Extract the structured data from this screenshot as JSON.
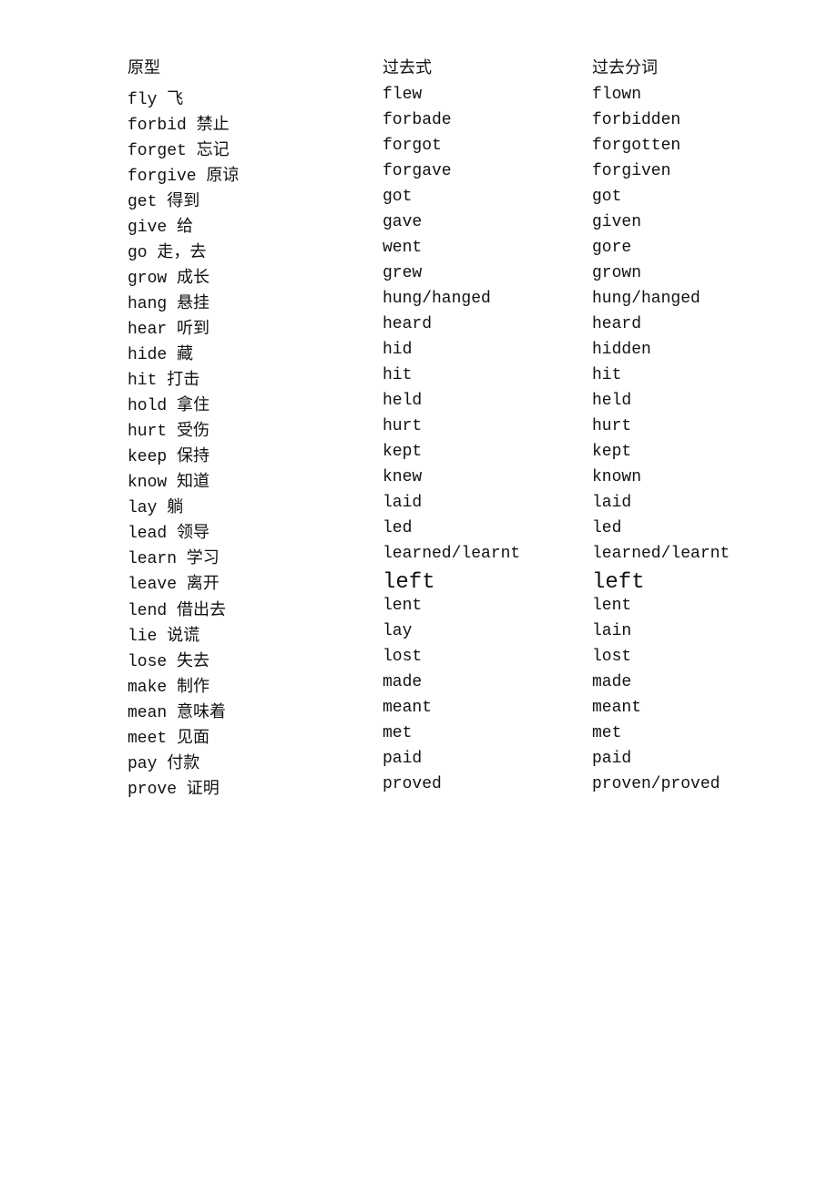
{
  "headers": {
    "col1": "原型",
    "col2": "过去式",
    "col3": "过去分词"
  },
  "rows": [
    {
      "col1": "fly 飞",
      "col2": "flew",
      "col3": "flown",
      "large": false
    },
    {
      "col1": "forbid 禁止",
      "col2": "forbade",
      "col3": "forbidden",
      "large": false
    },
    {
      "col1": "forget 忘记",
      "col2": "forgot",
      "col3": "forgotten",
      "large": false
    },
    {
      "col1": "forgive 原谅",
      "col2": "forgave",
      "col3": "forgiven",
      "large": false
    },
    {
      "col1": "get 得到",
      "col2": "got",
      "col3": "got",
      "large": false
    },
    {
      "col1": "give 给",
      "col2": "gave",
      "col3": "given",
      "large": false
    },
    {
      "col1": "go 走，去",
      "col2": "went",
      "col3": "gore",
      "large": false
    },
    {
      "col1": "grow 成长",
      "col2": "grew",
      "col3": "grown",
      "large": false
    },
    {
      "col1": "hang 悬挂",
      "col2": "hung/hanged",
      "col3": "hung/hanged",
      "large": false
    },
    {
      "col1": "hear 听到",
      "col2": "heard",
      "col3": "heard",
      "large": false
    },
    {
      "col1": "hide 藏",
      "col2": "hid",
      "col3": "hidden",
      "large": false
    },
    {
      "col1": "hit 打击",
      "col2": "hit",
      "col3": "hit",
      "large": false
    },
    {
      "col1": "hold 拿住",
      "col2": "held",
      "col3": "held",
      "large": false
    },
    {
      "col1": "hurt 受伤",
      "col2": "hurt",
      "col3": "hurt",
      "large": false
    },
    {
      "col1": "keep 保持",
      "col2": "kept",
      "col3": "kept",
      "large": false
    },
    {
      "col1": "know 知道",
      "col2": "knew",
      "col3": "known",
      "large": false
    },
    {
      "col1": "lay 躺",
      "col2": "laid",
      "col3": "laid",
      "large": false
    },
    {
      "col1": "lead 领导",
      "col2": "led",
      "col3": "led",
      "large": false
    },
    {
      "col1": "learn 学习",
      "col2": "learned/learnt",
      "col3": "learned/learnt",
      "large": false
    },
    {
      "col1": "leave 离开",
      "col2": "left",
      "col3": "left",
      "large": true
    },
    {
      "col1": "lend 借出去",
      "col2": "lent",
      "col3": "lent",
      "large": false
    },
    {
      "col1": "lie 说谎",
      "col2": "lay",
      "col3": "lain",
      "large": false
    },
    {
      "col1": "lose 失去",
      "col2": "lost",
      "col3": "lost",
      "large": false
    },
    {
      "col1": "make 制作",
      "col2": "made",
      "col3": "made",
      "large": false
    },
    {
      "col1": "mean 意味着",
      "col2": "meant",
      "col3": "meant",
      "large": false
    },
    {
      "col1": "meet 见面",
      "col2": "met",
      "col3": "met",
      "large": false
    },
    {
      "col1": "pay 付款",
      "col2": "paid",
      "col3": "paid",
      "large": false
    },
    {
      "col1": "prove 证明",
      "col2": "proved",
      "col3": "proven/proved",
      "large": false
    }
  ]
}
